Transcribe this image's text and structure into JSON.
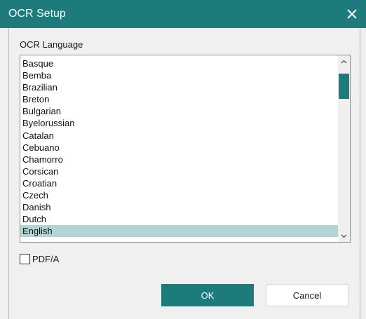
{
  "window": {
    "title": "OCR Setup",
    "accent_color": "#1e7b7b",
    "close_icon": "close-icon"
  },
  "ocr_language": {
    "label": "OCR Language",
    "items": [
      "Basque",
      "Bemba",
      "Brazilian",
      "Breton",
      "Bulgarian",
      "Byelorussian",
      "Catalan",
      "Cebuano",
      "Chamorro",
      "Corsican",
      "Croatian",
      "Czech",
      "Danish",
      "Dutch",
      "English"
    ],
    "selected": "English"
  },
  "pdfa": {
    "label": "PDF/A",
    "checked": false
  },
  "buttons": {
    "ok": "OK",
    "cancel": "Cancel"
  }
}
